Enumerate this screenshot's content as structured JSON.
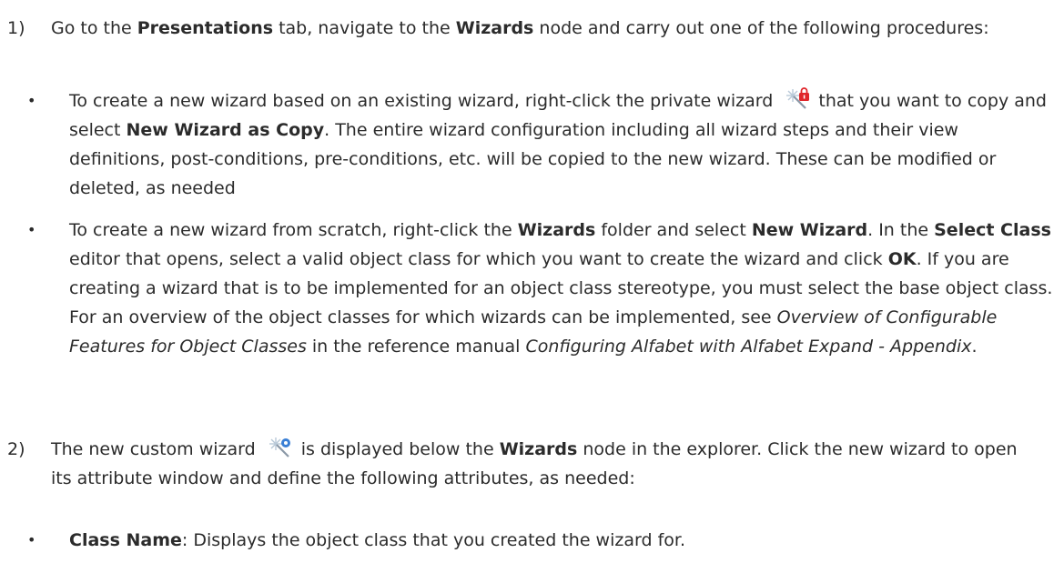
{
  "steps": [
    {
      "number": "1)",
      "parts": [
        "Go to the ",
        "Presentations",
        " tab, navigate to the ",
        "Wizards",
        " node and carry out one of the following procedures:"
      ],
      "bullets": [
        {
          "bullet": "•",
          "parts": [
            "To create a new wizard based on an existing wizard, right-click the private wizard ",
            " that you want to copy and select ",
            "New Wizard as Copy",
            ". The entire wizard configuration including all wizard steps and their view definitions, post-conditions, pre-conditions, etc. will be copied to the new wizard. These can be modified or deleted, as needed"
          ]
        },
        {
          "bullet": "•",
          "parts": [
            "To create a new wizard from scratch, right-click the ",
            "Wizards",
            " folder and select ",
            "New Wizard",
            ". In the ",
            "Select Class",
            " editor that opens, select a valid object class for which you want to create the wizard and click ",
            "OK",
            ". If you are creating a wizard that is to be implemented for an object class stereotype, you must select the base object class. For an overview of the object classes for which wizards can be implemented, see ",
            "Overview of Configurable Features for Object Classes",
            " in the reference manual ",
            "Configuring Alfabet with Alfabet Expand - Appendix",
            "."
          ]
        }
      ]
    },
    {
      "number": "2)",
      "parts": [
        "The new custom wizard ",
        " is displayed below the ",
        "Wizards",
        " node in the explorer. Click the new wizard to open its attribute window and define the following attributes, as needed:"
      ],
      "bullets": [
        {
          "bullet": "•",
          "parts": [
            "Class Name",
            ": Displays the object class that you created the wizard for."
          ]
        }
      ]
    }
  ],
  "icons": {
    "private_wizard": "private-wizard-icon",
    "custom_wizard": "custom-wizard-icon"
  },
  "colors": {
    "text": "#2b2b2b",
    "lock_red": "#e0262b",
    "badge_blue": "#3a7fd5"
  }
}
